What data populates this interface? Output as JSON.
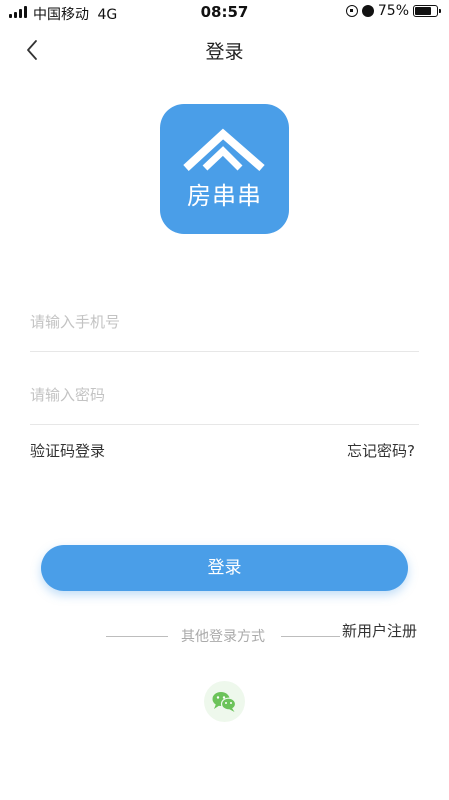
{
  "status_bar": {
    "carrier": "中国移动",
    "network": "4G",
    "time": "08:57",
    "battery": "75%",
    "battery_level": 0.75
  },
  "nav": {
    "back_icon": "chevron-left-icon",
    "title": "登录"
  },
  "logo": {
    "brand_text": "房串串",
    "color": "#4a9ee8"
  },
  "form": {
    "phone_placeholder": "请输入手机号",
    "phone_value": "",
    "password_placeholder": "请输入密码",
    "password_value": ""
  },
  "links": {
    "code_login": "验证码登录",
    "forgot_password": "忘记密码?"
  },
  "login_button": "登录",
  "other_login_label": "其他登录方式",
  "register_link": "新用户注册",
  "wechat_icon": "wechat-icon",
  "colors": {
    "primary": "#4a9ee8",
    "wechat_green": "#6cc35a"
  }
}
